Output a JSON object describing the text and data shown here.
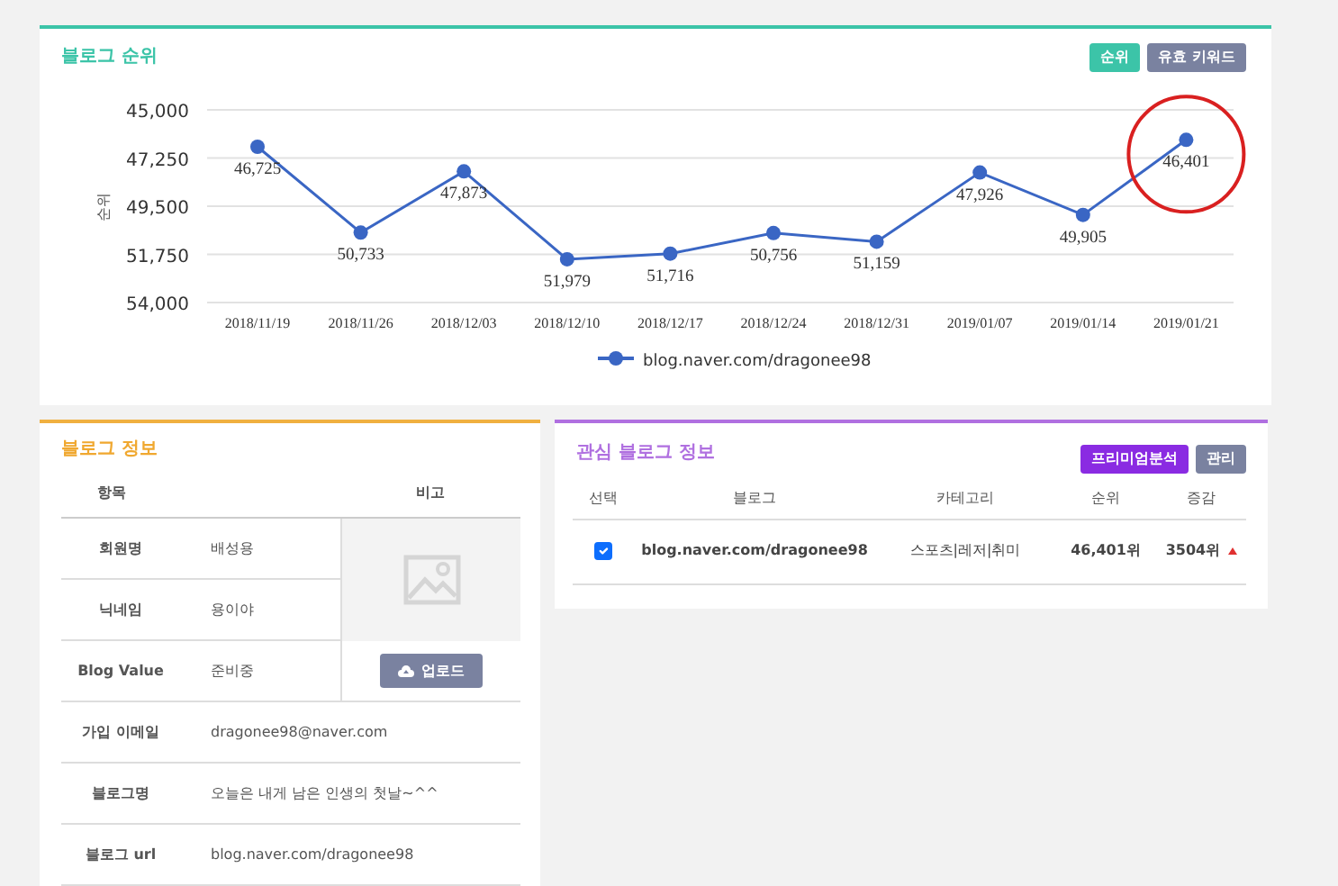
{
  "rank_card": {
    "title": "블로그 순위",
    "buttons": [
      {
        "label": "순위",
        "selected": true
      },
      {
        "label": "유효 키워드",
        "selected": false
      }
    ],
    "chart_data": {
      "type": "line",
      "ylabel": "순위",
      "categories": [
        "2018/11/19",
        "2018/11/26",
        "2018/12/03",
        "2018/12/10",
        "2018/12/17",
        "2018/12/24",
        "2018/12/31",
        "2019/01/07",
        "2019/01/14",
        "2019/01/21"
      ],
      "series": [
        {
          "name": "blog.naver.com/dragonee98",
          "color": "#3a66c4",
          "marker": "circle",
          "values": [
            46725,
            50733,
            47873,
            51979,
            51716,
            50756,
            51159,
            47926,
            49905,
            46401
          ]
        }
      ],
      "ylim": [
        54000,
        45000
      ],
      "yticks": [
        {
          "value": 45000,
          "label": "45,000"
        },
        {
          "value": 47250,
          "label": "47,250"
        },
        {
          "value": 49500,
          "label": "49,500"
        },
        {
          "value": 51750,
          "label": "51,750"
        },
        {
          "value": 54000,
          "label": "54,000"
        }
      ],
      "value_labels": [
        "46,725",
        "50,733",
        "47,873",
        "51,979",
        "51,716",
        "50,756",
        "51,159",
        "47,926",
        "49,905",
        "46,401"
      ],
      "grid": true
    },
    "highlighted_points": [
      false,
      false,
      false,
      false,
      false,
      false,
      false,
      false,
      false,
      true
    ]
  },
  "info_card": {
    "title": "블로그 정보",
    "columns": [
      "항목",
      "비고"
    ],
    "rows": [
      {
        "label": "회원명",
        "value": "배성용"
      },
      {
        "label": "닉네임",
        "value": "용이야"
      },
      {
        "label": "Blog Value",
        "value": "준비중"
      },
      {
        "label": "가입 이메일",
        "value": "dragonee98@naver.com"
      },
      {
        "label": "블로그명",
        "value": "오늘은 내게 남은 인생의 첫날~^^"
      },
      {
        "label": "블로그 url",
        "value": "blog.naver.com/dragonee98"
      }
    ],
    "upload_button": "업로드"
  },
  "watch_card": {
    "title": "관심 블로그 정보",
    "buttons": [
      "프리미엄분석",
      "관리"
    ],
    "columns": [
      "선택",
      "블로그",
      "카테고리",
      "순위",
      "증감"
    ],
    "rows": [
      {
        "checked": true,
        "blog": "blog.naver.com/dragonee98",
        "category": "스포츠|레저|취미",
        "rank": "46,401위",
        "change": "3504위",
        "rising": true
      }
    ]
  }
}
